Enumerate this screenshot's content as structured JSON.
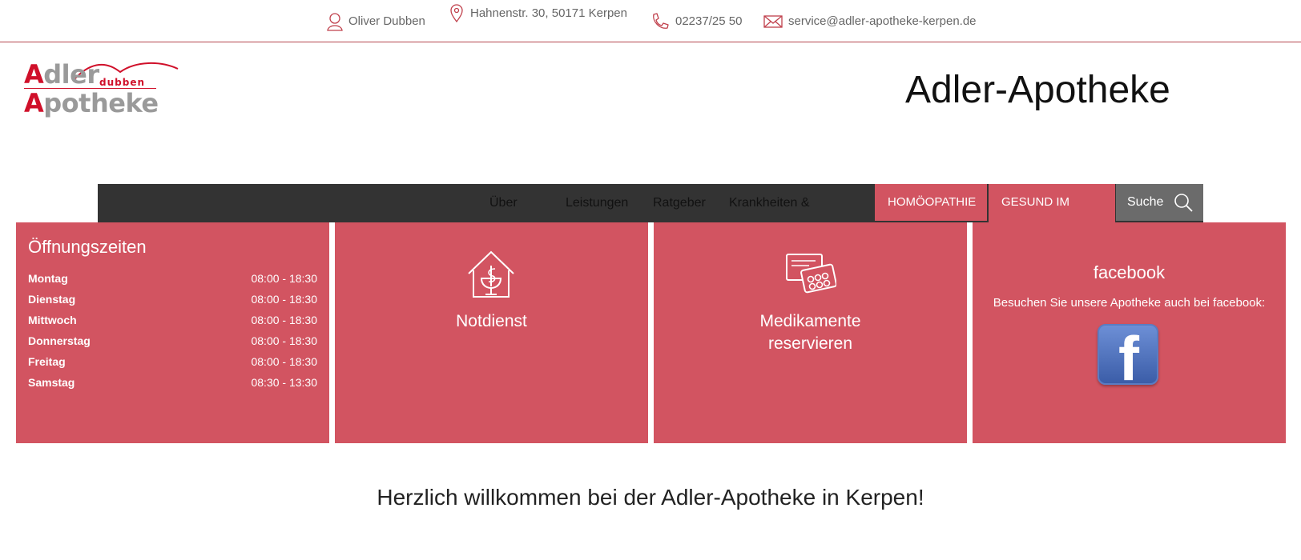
{
  "topbar": {
    "name": "Oliver Dubben",
    "address": "Hahnenstr. 30, 50171 Kerpen",
    "phone": "02237/25 50",
    "email": "service@adler-apotheke-kerpen.de"
  },
  "logo": {
    "line1_cap": "A",
    "line1_rest": "dler",
    "sub": "dubben",
    "line2_cap": "A",
    "line2_rest": "potheke"
  },
  "site_title": "Adler-Apotheke",
  "nav": {
    "items": [
      "Über",
      "Leistungen",
      "Ratgeber",
      "Krankheiten &"
    ],
    "highlight": [
      "HOMÖOPATHIE",
      "GESUND IM"
    ],
    "search_label": "Suche"
  },
  "hours": {
    "title": "Öffnungszeiten",
    "rows": [
      {
        "day": "Montag",
        "time": "08:00 - 18:30"
      },
      {
        "day": "Dienstag",
        "time": "08:00 - 18:30"
      },
      {
        "day": "Mittwoch",
        "time": "08:00 - 18:30"
      },
      {
        "day": "Donnerstag",
        "time": "08:00 - 18:30"
      },
      {
        "day": "Freitag",
        "time": "08:00 - 18:30"
      },
      {
        "day": "Samstag",
        "time": "08:30 - 13:30"
      }
    ]
  },
  "tiles": {
    "notdienst": "Notdienst",
    "medikamente_line1": "Medikamente",
    "medikamente_line2": "reservieren",
    "facebook_title": "facebook",
    "facebook_text": "Besuchen Sie unsere Apotheke auch bei facebook:"
  },
  "welcome": "Herzlich willkommen bei der Adler-Apotheke in Kerpen!",
  "colors": {
    "accent": "#d25461",
    "nav_bg": "#333333",
    "search_bg": "#6b6b6b",
    "brand_red": "#d0102a"
  }
}
